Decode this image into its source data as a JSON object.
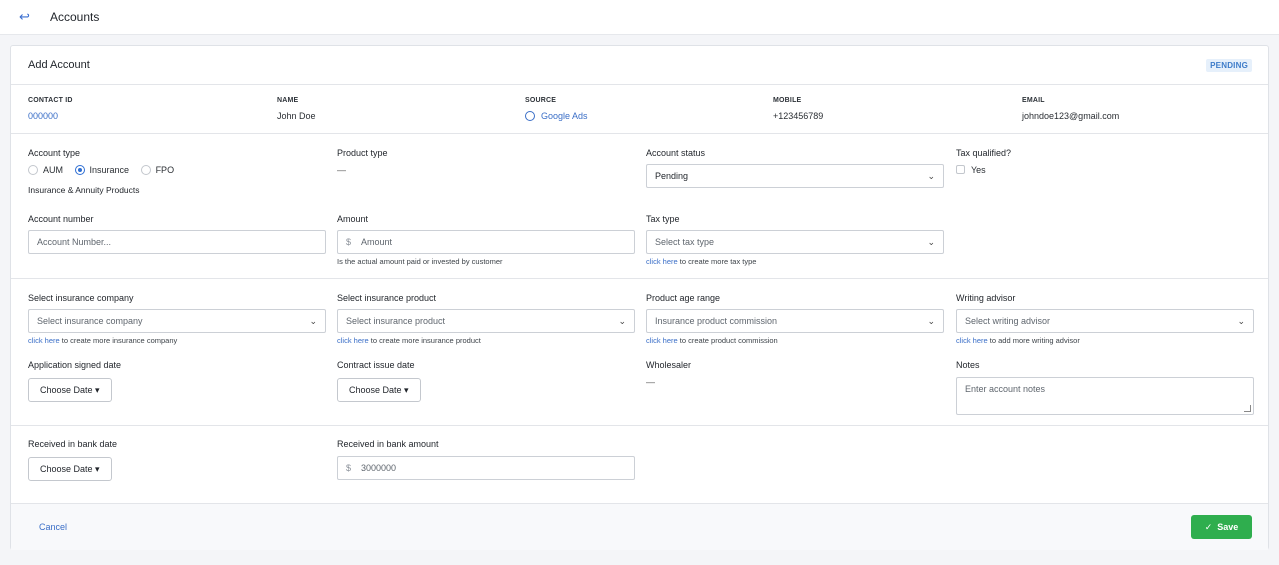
{
  "header": {
    "back_icon": "back-arrow-icon",
    "title": "Accounts"
  },
  "card": {
    "title": "Add Account",
    "status_badge": "PENDING"
  },
  "info": {
    "contact_id": {
      "label": "CONTACT ID",
      "value": "000000"
    },
    "name": {
      "label": "NAME",
      "value": "John Doe"
    },
    "source": {
      "label": "SOURCE",
      "value": "Google Ads"
    },
    "mobile": {
      "label": "MOBILE",
      "value": "+123456789"
    },
    "email": {
      "label": "EMAIL",
      "value": "johndoe123@gmail.com"
    }
  },
  "form": {
    "account_type": {
      "label": "Account type",
      "options": [
        "AUM",
        "Insurance",
        "FPO"
      ],
      "selected": "Insurance",
      "subtext": "Insurance & Annuity Products"
    },
    "product_type": {
      "label": "Product type",
      "value": "—"
    },
    "account_status": {
      "label": "Account status",
      "value": "Pending"
    },
    "tax_qualified": {
      "label": "Tax qualified?",
      "option": "Yes"
    },
    "account_number": {
      "label": "Account number",
      "placeholder": "Account Number..."
    },
    "amount": {
      "label": "Amount",
      "currency": "$",
      "placeholder": "Amount",
      "help": "Is the actual amount paid or invested by customer"
    },
    "tax_type": {
      "label": "Tax type",
      "placeholder": "Select tax type",
      "help_link": "click here",
      "help_text": " to create more tax type"
    },
    "insurance_company": {
      "label": "Select insurance company",
      "placeholder": "Select insurance company",
      "help_link": "click here",
      "help_text": " to create more insurance company"
    },
    "insurance_product": {
      "label": "Select insurance product",
      "placeholder": "Select insurance product",
      "help_link": "click here",
      "help_text": " to create more insurance product"
    },
    "product_age_range": {
      "label": "Product age range",
      "placeholder": "Insurance product commission",
      "help_link": "click here",
      "help_text": " to create product commission"
    },
    "writing_advisor": {
      "label": "Writing advisor",
      "placeholder": "Select writing advisor",
      "help_link": "click here",
      "help_text": " to add more writing advisor"
    },
    "application_signed_date": {
      "label": "Application signed date",
      "button": "Choose Date ▾"
    },
    "contract_issue_date": {
      "label": "Contract issue date",
      "button": "Choose Date ▾"
    },
    "wholesaler": {
      "label": "Wholesaler",
      "value": "—"
    },
    "notes": {
      "label": "Notes",
      "placeholder": "Enter account notes"
    },
    "received_in_bank_date": {
      "label": "Received in bank date",
      "button": "Choose Date ▾"
    },
    "received_in_bank_amount": {
      "label": "Received in bank amount",
      "currency": "$",
      "value": "3000000"
    }
  },
  "footer": {
    "cancel": "Cancel",
    "save": "Save",
    "save_icon": "check-icon"
  },
  "colors": {
    "accent": "#3a6ec7",
    "save": "#2fae4e",
    "badge_bg": "#e6f0fb"
  }
}
